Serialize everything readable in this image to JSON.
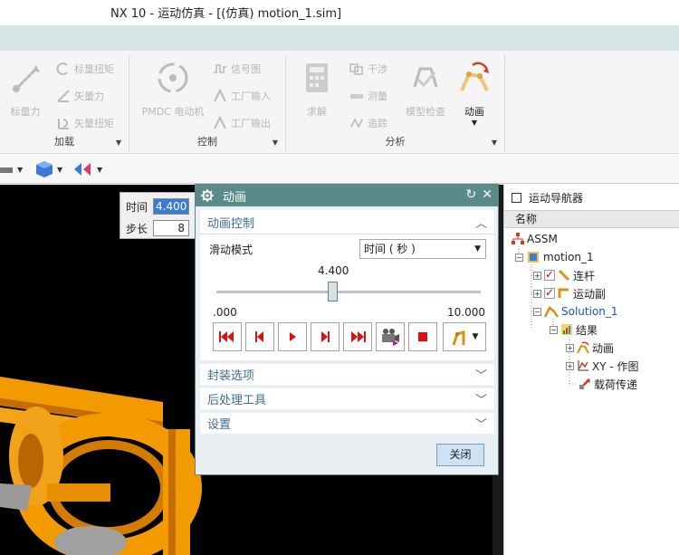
{
  "window": {
    "title": "NX 10 - 运动仿真 - [(仿真) motion_1.sim]"
  },
  "ribbon": {
    "groups": [
      {
        "label": "加载",
        "items": [
          "标量力",
          "标量扭矩",
          "矢量力",
          "矢量扭矩"
        ]
      },
      {
        "label": "控制",
        "items": [
          "PMDC 电动机",
          "信号图",
          "工厂输入",
          "工厂输出"
        ]
      },
      {
        "label": "分析",
        "items": [
          "求解",
          "干涉",
          "测量",
          "追踪",
          "模型检查",
          "动画"
        ]
      }
    ]
  },
  "timebox": {
    "time_label": "时间",
    "time_value": "4.400",
    "step_label": "步长",
    "step_value": "8"
  },
  "dialog": {
    "title": "动画",
    "section_anim": "动画控制",
    "slide_mode_label": "滑动模式",
    "slide_mode_value": "时间 ( 秒 )",
    "slider_value": "4.400",
    "slider_min": ".000",
    "slider_max": "10.000",
    "slider_fraction": 0.44,
    "section_pack": "封装选项",
    "section_post": "后处理工具",
    "section_settings": "设置",
    "close_label": "关闭"
  },
  "navigator": {
    "title": "运动导航器",
    "col_name": "名称",
    "tree": [
      {
        "label": "ASSM"
      },
      {
        "label": "motion_1"
      },
      {
        "label": "连杆"
      },
      {
        "label": "运动副"
      },
      {
        "label": "Solution_1"
      },
      {
        "label": "结果"
      },
      {
        "label": "动画"
      },
      {
        "label": "XY - 作图"
      },
      {
        "label": "载荷传递"
      }
    ]
  },
  "colors": {
    "dialog_title": "#5a8a89",
    "section_text": "#3c6f8f",
    "accent_orange": "#f29a00",
    "link_blue": "#1a4fd6"
  }
}
